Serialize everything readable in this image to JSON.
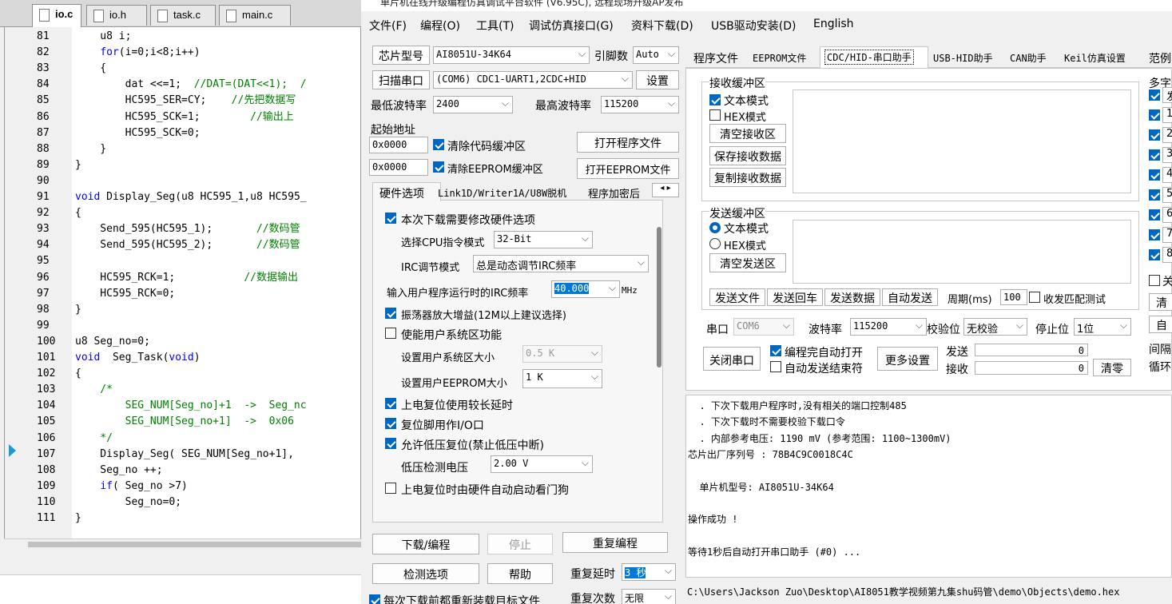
{
  "editor": {
    "tabs": [
      "io.c",
      "io.h",
      "task.c",
      "main.c"
    ],
    "lines": [
      {
        "n": "81",
        "code": "    u8 i;"
      },
      {
        "n": "82",
        "code": "    for(i=0;i<8;i++)"
      },
      {
        "n": "83",
        "code": "    {"
      },
      {
        "n": "84",
        "code": "        dat <<=1;  //DAT=(DAT<<1);  /"
      },
      {
        "n": "85",
        "code": "        HC595_SER=CY;    //先把数据写"
      },
      {
        "n": "86",
        "code": "        HC595_SCK=1;        //输出上"
      },
      {
        "n": "87",
        "code": "        HC595_SCK=0;"
      },
      {
        "n": "88",
        "code": "    }"
      },
      {
        "n": "89",
        "code": "}"
      },
      {
        "n": "90",
        "code": ""
      },
      {
        "n": "91",
        "code": "void Display_Seg(u8 HC595_1,u8 HC595_"
      },
      {
        "n": "92",
        "code": "{"
      },
      {
        "n": "93",
        "code": "    Send_595(HC595_1);       //数码管"
      },
      {
        "n": "94",
        "code": "    Send_595(HC595_2);       //数码管"
      },
      {
        "n": "95",
        "code": ""
      },
      {
        "n": "96",
        "code": "    HC595_RCK=1;           //数据输出"
      },
      {
        "n": "97",
        "code": "    HC595_RCK=0;"
      },
      {
        "n": "98",
        "code": "}"
      },
      {
        "n": "99",
        "code": ""
      },
      {
        "n": "100",
        "code": "u8 Seg_no=0;"
      },
      {
        "n": "101",
        "code": "void  Seg_Task(void)"
      },
      {
        "n": "102",
        "code": "{"
      },
      {
        "n": "103",
        "code": "    /*"
      },
      {
        "n": "104",
        "code": "        SEG_NUM[Seg_no]+1  ->  Seg_nc"
      },
      {
        "n": "105",
        "code": "        SEG_NUM[Seg_no+1]  ->  0x06"
      },
      {
        "n": "106",
        "code": "    */"
      },
      {
        "n": "107",
        "code": "    Display_Seg( SEG_NUM[Seg_no+1], "
      },
      {
        "n": "108",
        "code": "    Seg_no ++;"
      },
      {
        "n": "109",
        "code": "    if( Seg_no >7)"
      },
      {
        "n": "110",
        "code": "        Seg_no=0;"
      },
      {
        "n": "111",
        "code": "}"
      }
    ]
  },
  "prog": {
    "title": "单片机在线升级编程仿真调试平台软件 (V6.95C), 远程现场升级AP发布",
    "menu": [
      "文件(F)",
      "编程(O)",
      "工具(T)",
      "调试仿真接口(G)",
      "资料下载(D)",
      "USB驱动安装(D)",
      "English"
    ],
    "left": {
      "chip_btn": "芯片型号",
      "chip_value": "AI8051U-34K64",
      "pins_label": "引脚数",
      "pins_value": "Auto",
      "scan_btn": "扫描串口",
      "port_value": "(COM6) CDC1-UART1,2CDC+HID",
      "settings_btn": "设置",
      "min_baud_label": "最低波特率",
      "min_baud": "2400",
      "max_baud_label": "最高波特率",
      "max_baud": "115200",
      "start_addr_label": "起始地址",
      "addr1": "0x0000",
      "clear_code": "清除代码缓冲区",
      "open_prog": "打开程序文件",
      "addr2": "0x0000",
      "clear_eeprom": "清除EEPROM缓冲区",
      "open_eeprom": "打开EEPROM文件",
      "hw_tabs": [
        "硬件选项",
        "Link1D/Writer1A/U8W脱机",
        "程序加密后"
      ],
      "opt_modify_hw": "本次下载需要修改硬件选项",
      "cpu_mode_label": "选择CPU指令模式",
      "cpu_mode": "32-Bit",
      "irc_mode_label": "IRC调节模式",
      "irc_mode": "总是动态调节IRC频率",
      "irc_freq_label": "输入用户程序运行时的IRC频率",
      "irc_freq": "40.000",
      "irc_unit": "MHz",
      "opt_osc": "振荡器放大增益(12M以上建议选择)",
      "opt_sysarea": "使能用户系统区功能",
      "sys_size_label": "设置用户系统区大小",
      "sys_size": "0.5 K",
      "eeprom_size_label": "设置用户EEPROM大小",
      "eeprom_size": "1   K",
      "opt_long_delay": "上电复位使用较长延时",
      "opt_reset_io": "复位脚用作I/O口",
      "opt_lvr": "允许低压复位(禁止低压中断)",
      "lv_label": "低压检测电压",
      "lv_value": "2.00 V",
      "opt_wdt": "上电复位时由硬件自动启动看门狗",
      "download_btn": "下载/编程",
      "stop_btn": "停止",
      "reprog_btn": "重复编程",
      "check_btn": "检测选项",
      "help_btn": "帮助",
      "repeat_delay_label": "重复延时",
      "repeat_delay": "3 秒",
      "reload_label": "每次下载前都重新装载目标文件",
      "repeat_count_label": "重复次数",
      "repeat_count": "无限"
    },
    "right": {
      "tabs": [
        "程序文件",
        "EEPROM文件",
        "CDC/HID-串口助手",
        "USB-HID助手",
        "CAN助手",
        "Keil仿真设置",
        "范例"
      ],
      "recv_title": "接收缓冲区",
      "text_mode": "文本模式",
      "hex_mode": "HEX模式",
      "clear_recv": "清空接收区",
      "save_recv": "保存接收数据",
      "copy_recv": "复制接收数据",
      "send_title": "发送缓冲区",
      "clear_send": "清空发送区",
      "send_file": "发送文件",
      "send_enter": "发送回车",
      "send_data": "发送数据",
      "auto_send": "自动发送",
      "period_label": "周期(ms)",
      "period": "100",
      "match_test": "收发匹配测试",
      "port_label": "串口",
      "port": "COM6",
      "baud_label": "波特率",
      "baud": "115200",
      "parity_label": "校验位",
      "parity": "无校验",
      "stop_label": "停止位",
      "stop": "1位",
      "close_port": "关闭串口",
      "auto_open": "编程完自动打开",
      "auto_send_end": "自动发送结束符",
      "more_settings": "更多设置",
      "send_label": "发送",
      "send_count": "0",
      "recv_label": "接收",
      "recv_count": "0",
      "clear_btn": "清零",
      "multi_title": "多字",
      "multi_letters": [
        "发",
        "1",
        "2",
        "3",
        "4",
        "5",
        "6",
        "7",
        "8"
      ],
      "close_label": "关",
      "clear_short": "清",
      "auto_short": "自",
      "interval_label": "间隔",
      "loop_label": "循环"
    },
    "log": [
      "  . 下次下载用户程序时,没有相关的端口控制485",
      "  . 下次下载时不需要校验下载口令",
      "  . 内部参考电压: 1190 mV (参考范围: 1100~1300mV)",
      "芯片出厂序列号 : 78B4C9C0018C4C",
      "",
      "  单片机型号: AI8051U-34K64",
      "",
      "操作成功 !",
      "",
      "等待1秒后自动打开串口助手 (#0) ..."
    ],
    "status_path": "C:\\Users\\Jackson Zuo\\Desktop\\AI8051教学视频第九集shu码管\\demo\\Objects\\demo.hex"
  }
}
